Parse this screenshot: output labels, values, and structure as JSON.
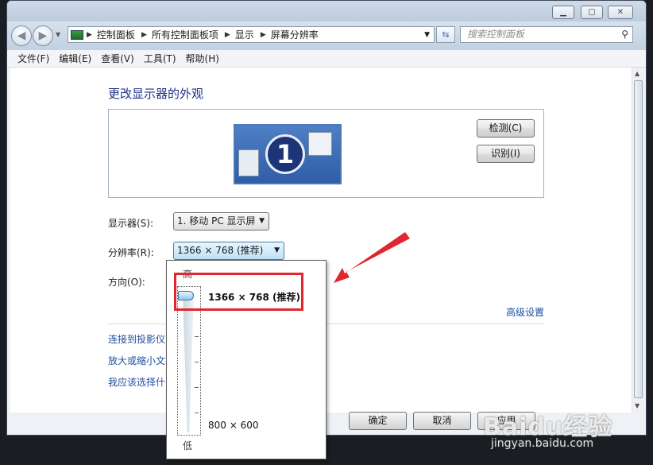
{
  "address": {
    "crumbs": [
      "控制面板",
      "所有控制面板项",
      "显示",
      "屏幕分辨率"
    ]
  },
  "search": {
    "placeholder": "搜索控制面板"
  },
  "menu": [
    "文件(F)",
    "编辑(E)",
    "查看(V)",
    "工具(T)",
    "帮助(H)"
  ],
  "page": {
    "title": "更改显示器的外观",
    "monitor_number": "1",
    "detect_button": "检测(C)",
    "identify_button": "识别(I)",
    "display_label": "显示器(S):",
    "display_value": "1. 移动 PC 显示屏",
    "resolution_label": "分辨率(R):",
    "resolution_value": "1366 × 768 (推荐)",
    "orientation_label": "方向(O):",
    "advanced_link": "高级设置",
    "links": [
      "连接到投影仪 (",
      "放大或缩小文本",
      "我应该选择什么"
    ],
    "bottom_buttons": [
      "确定",
      "取消",
      "应用"
    ]
  },
  "popup": {
    "high_label": "高",
    "low_label": "低",
    "option_top": "1366 × 768 (推荐)",
    "option_bottom": "800 × 600",
    "slider_level": 1.0
  },
  "watermark": {
    "brand": "Baidu经验",
    "url": "jingyan.baidu.com"
  },
  "colors": {
    "link": "#1e4fa1",
    "heading": "#1e3287",
    "annotation": "#e0262e"
  }
}
